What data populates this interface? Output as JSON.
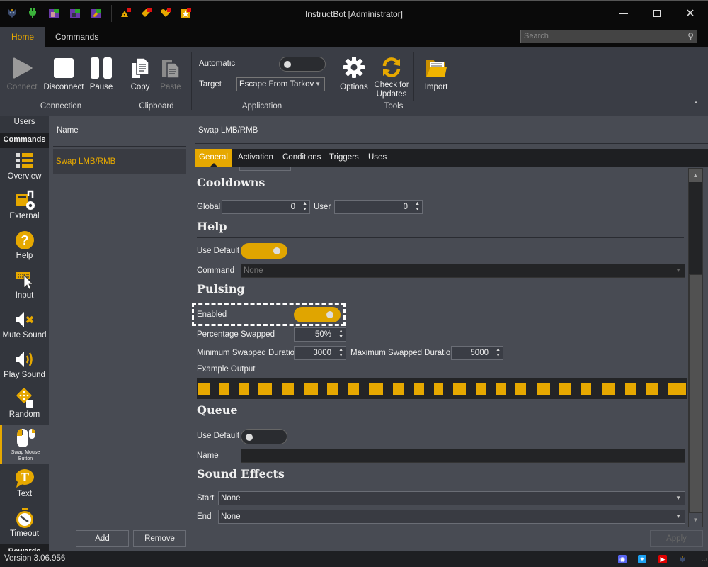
{
  "window": {
    "title": "InstructBot [Administrator]",
    "controls": [
      "minimize",
      "maximize",
      "close"
    ]
  },
  "quick_access": [
    {
      "name": "app-logo-icon"
    },
    {
      "name": "plug-icon"
    },
    {
      "name": "twitch-streamer-icon"
    },
    {
      "name": "twitch-bot-icon"
    },
    {
      "name": "twitch-events-icon"
    },
    {
      "name": "bits-icon"
    },
    {
      "name": "tag-icon"
    },
    {
      "name": "heart-icon"
    },
    {
      "name": "star-icon"
    }
  ],
  "ribbon_tabs": [
    {
      "label": "Home",
      "active": true
    },
    {
      "label": "Commands",
      "active": false
    }
  ],
  "search": {
    "placeholder": "Search"
  },
  "ribbon": {
    "connection": {
      "group_label": "Connection",
      "connect": "Connect",
      "disconnect": "Disconnect",
      "pause": "Pause"
    },
    "clipboard": {
      "group_label": "Clipboard",
      "copy": "Copy",
      "paste": "Paste"
    },
    "application": {
      "group_label": "Application",
      "automatic_label": "Automatic",
      "automatic_on": false,
      "target_label": "Target",
      "target_value": "Escape From Tarkov"
    },
    "tools": {
      "group_label": "Tools",
      "options": "Options",
      "check_updates_line1": "Check for",
      "check_updates_line2": "Updates"
    },
    "import": {
      "label": "Import"
    }
  },
  "sidebar": {
    "top_item": "Users",
    "section_header": "Commands",
    "items": [
      {
        "label": "Overview"
      },
      {
        "label": "External"
      },
      {
        "label": "Help"
      },
      {
        "label": "Input"
      },
      {
        "label": "Mute Sound"
      },
      {
        "label": "Play Sound"
      },
      {
        "label": "Random"
      },
      {
        "label": "Swap Mouse Button",
        "active": true
      },
      {
        "label": "Text"
      },
      {
        "label": "Timeout"
      }
    ],
    "next_section": "Rewards"
  },
  "list": {
    "column_header": "Name",
    "items": [
      {
        "label": "Swap LMB/RMB",
        "selected": true
      }
    ],
    "add_button": "Add",
    "remove_button": "Remove"
  },
  "detail": {
    "title": "Swap LMB/RMB",
    "tabs": [
      {
        "label": "General",
        "active": true
      },
      {
        "label": "Activation"
      },
      {
        "label": "Conditions"
      },
      {
        "label": "Triggers"
      },
      {
        "label": "Uses"
      }
    ],
    "cooldowns": {
      "heading": "Cooldowns",
      "global_label": "Global",
      "global_value": "0",
      "user_label": "User",
      "user_value": "0"
    },
    "help": {
      "heading": "Help",
      "use_default_label": "Use Default",
      "use_default_on": true,
      "command_label": "Command",
      "command_value": "None"
    },
    "pulsing": {
      "heading": "Pulsing",
      "enabled_label": "Enabled",
      "enabled_on": true,
      "percentage_label": "Percentage Swapped",
      "percentage_value": "50%",
      "min_label": "Minimum Swapped Duration",
      "min_value": "3000",
      "max_label": "Maximum Swapped Duration",
      "max_value": "5000",
      "example_label": "Example Output",
      "example_pulses": [
        [
          0.2,
          2.5
        ],
        [
          4.4,
          6.5
        ],
        [
          8.5,
          10.5
        ],
        [
          12.5,
          15.2
        ],
        [
          17.2,
          19.7
        ],
        [
          21.7,
          24.6
        ],
        [
          26.5,
          28.8
        ],
        [
          30.8,
          33.0
        ],
        [
          35.0,
          37.9
        ],
        [
          40.0,
          42.3
        ],
        [
          44.4,
          46.4
        ],
        [
          48.4,
          50.3
        ],
        [
          52.3,
          54.9
        ],
        [
          57.0,
          59.0
        ],
        [
          61.0,
          63.0
        ],
        [
          65.0,
          67.3
        ],
        [
          69.4,
          72.2
        ],
        [
          74.1,
          76.4
        ],
        [
          78.5,
          80.6
        ],
        [
          82.7,
          85.4
        ],
        [
          87.5,
          89.7
        ],
        [
          91.8,
          94.2
        ],
        [
          96.2,
          100
        ]
      ]
    },
    "queue": {
      "heading": "Queue",
      "use_default_label": "Use Default",
      "use_default_on": false,
      "name_label": "Name",
      "name_value": ""
    },
    "sound_effects": {
      "heading": "Sound Effects",
      "start_label": "Start",
      "start_value": "None",
      "end_label": "End",
      "end_value": "None"
    },
    "apply_button": "Apply"
  },
  "status_bar": {
    "version": "Version 3.06.956",
    "links": [
      {
        "name": "discord-icon",
        "color": "#5865f2"
      },
      {
        "name": "twitter-icon",
        "color": "#1da1f2"
      },
      {
        "name": "youtube-icon",
        "color": "#e00000"
      },
      {
        "name": "app-logo-small-icon"
      }
    ]
  },
  "colors": {
    "accent": "#e6a800",
    "background": "#484b53",
    "ribbon": "#3a3d45",
    "titlebar": "#0a0a0a"
  }
}
